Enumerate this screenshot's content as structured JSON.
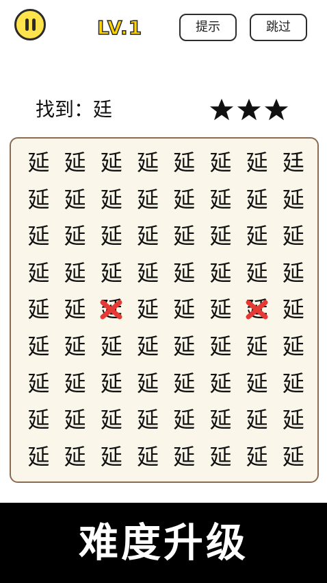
{
  "header": {
    "pause_icon": "pause-icon",
    "level": "LV.1",
    "hint_label": "提示",
    "skip_label": "跳过"
  },
  "task": {
    "find_label": "找到：廷",
    "stars": [
      "star-icon",
      "star-icon",
      "star-icon"
    ]
  },
  "board": {
    "rows": [
      [
        "延",
        "延",
        "延",
        "延",
        "延",
        "延",
        "延",
        "廷"
      ],
      [
        "延",
        "延",
        "延",
        "延",
        "延",
        "延",
        "延",
        "延"
      ],
      [
        "延",
        "延",
        "延",
        "延",
        "延",
        "延",
        "延",
        "延"
      ],
      [
        "延",
        "延",
        "延",
        "延",
        "延",
        "延",
        "延",
        "延"
      ],
      [
        "延",
        "延",
        "延",
        "延",
        "延",
        "延",
        "延",
        "延"
      ],
      [
        "延",
        "延",
        "延",
        "延",
        "延",
        "延",
        "延",
        "延"
      ],
      [
        "延",
        "延",
        "延",
        "延",
        "延",
        "延",
        "延",
        "延"
      ],
      [
        "延",
        "延",
        "延",
        "延",
        "延",
        "延",
        "延",
        "延"
      ],
      [
        "延",
        "延",
        "延",
        "延",
        "延",
        "延",
        "延",
        "延"
      ]
    ],
    "wrong_marks": [
      [
        4,
        2
      ],
      [
        4,
        6
      ]
    ],
    "wrong_mark_color": "#e53935"
  },
  "banner": {
    "text": "难度升级"
  },
  "colors": {
    "accent": "#ffe34d",
    "board_bg": "#faf7ea",
    "board_border": "#8a6a50"
  }
}
